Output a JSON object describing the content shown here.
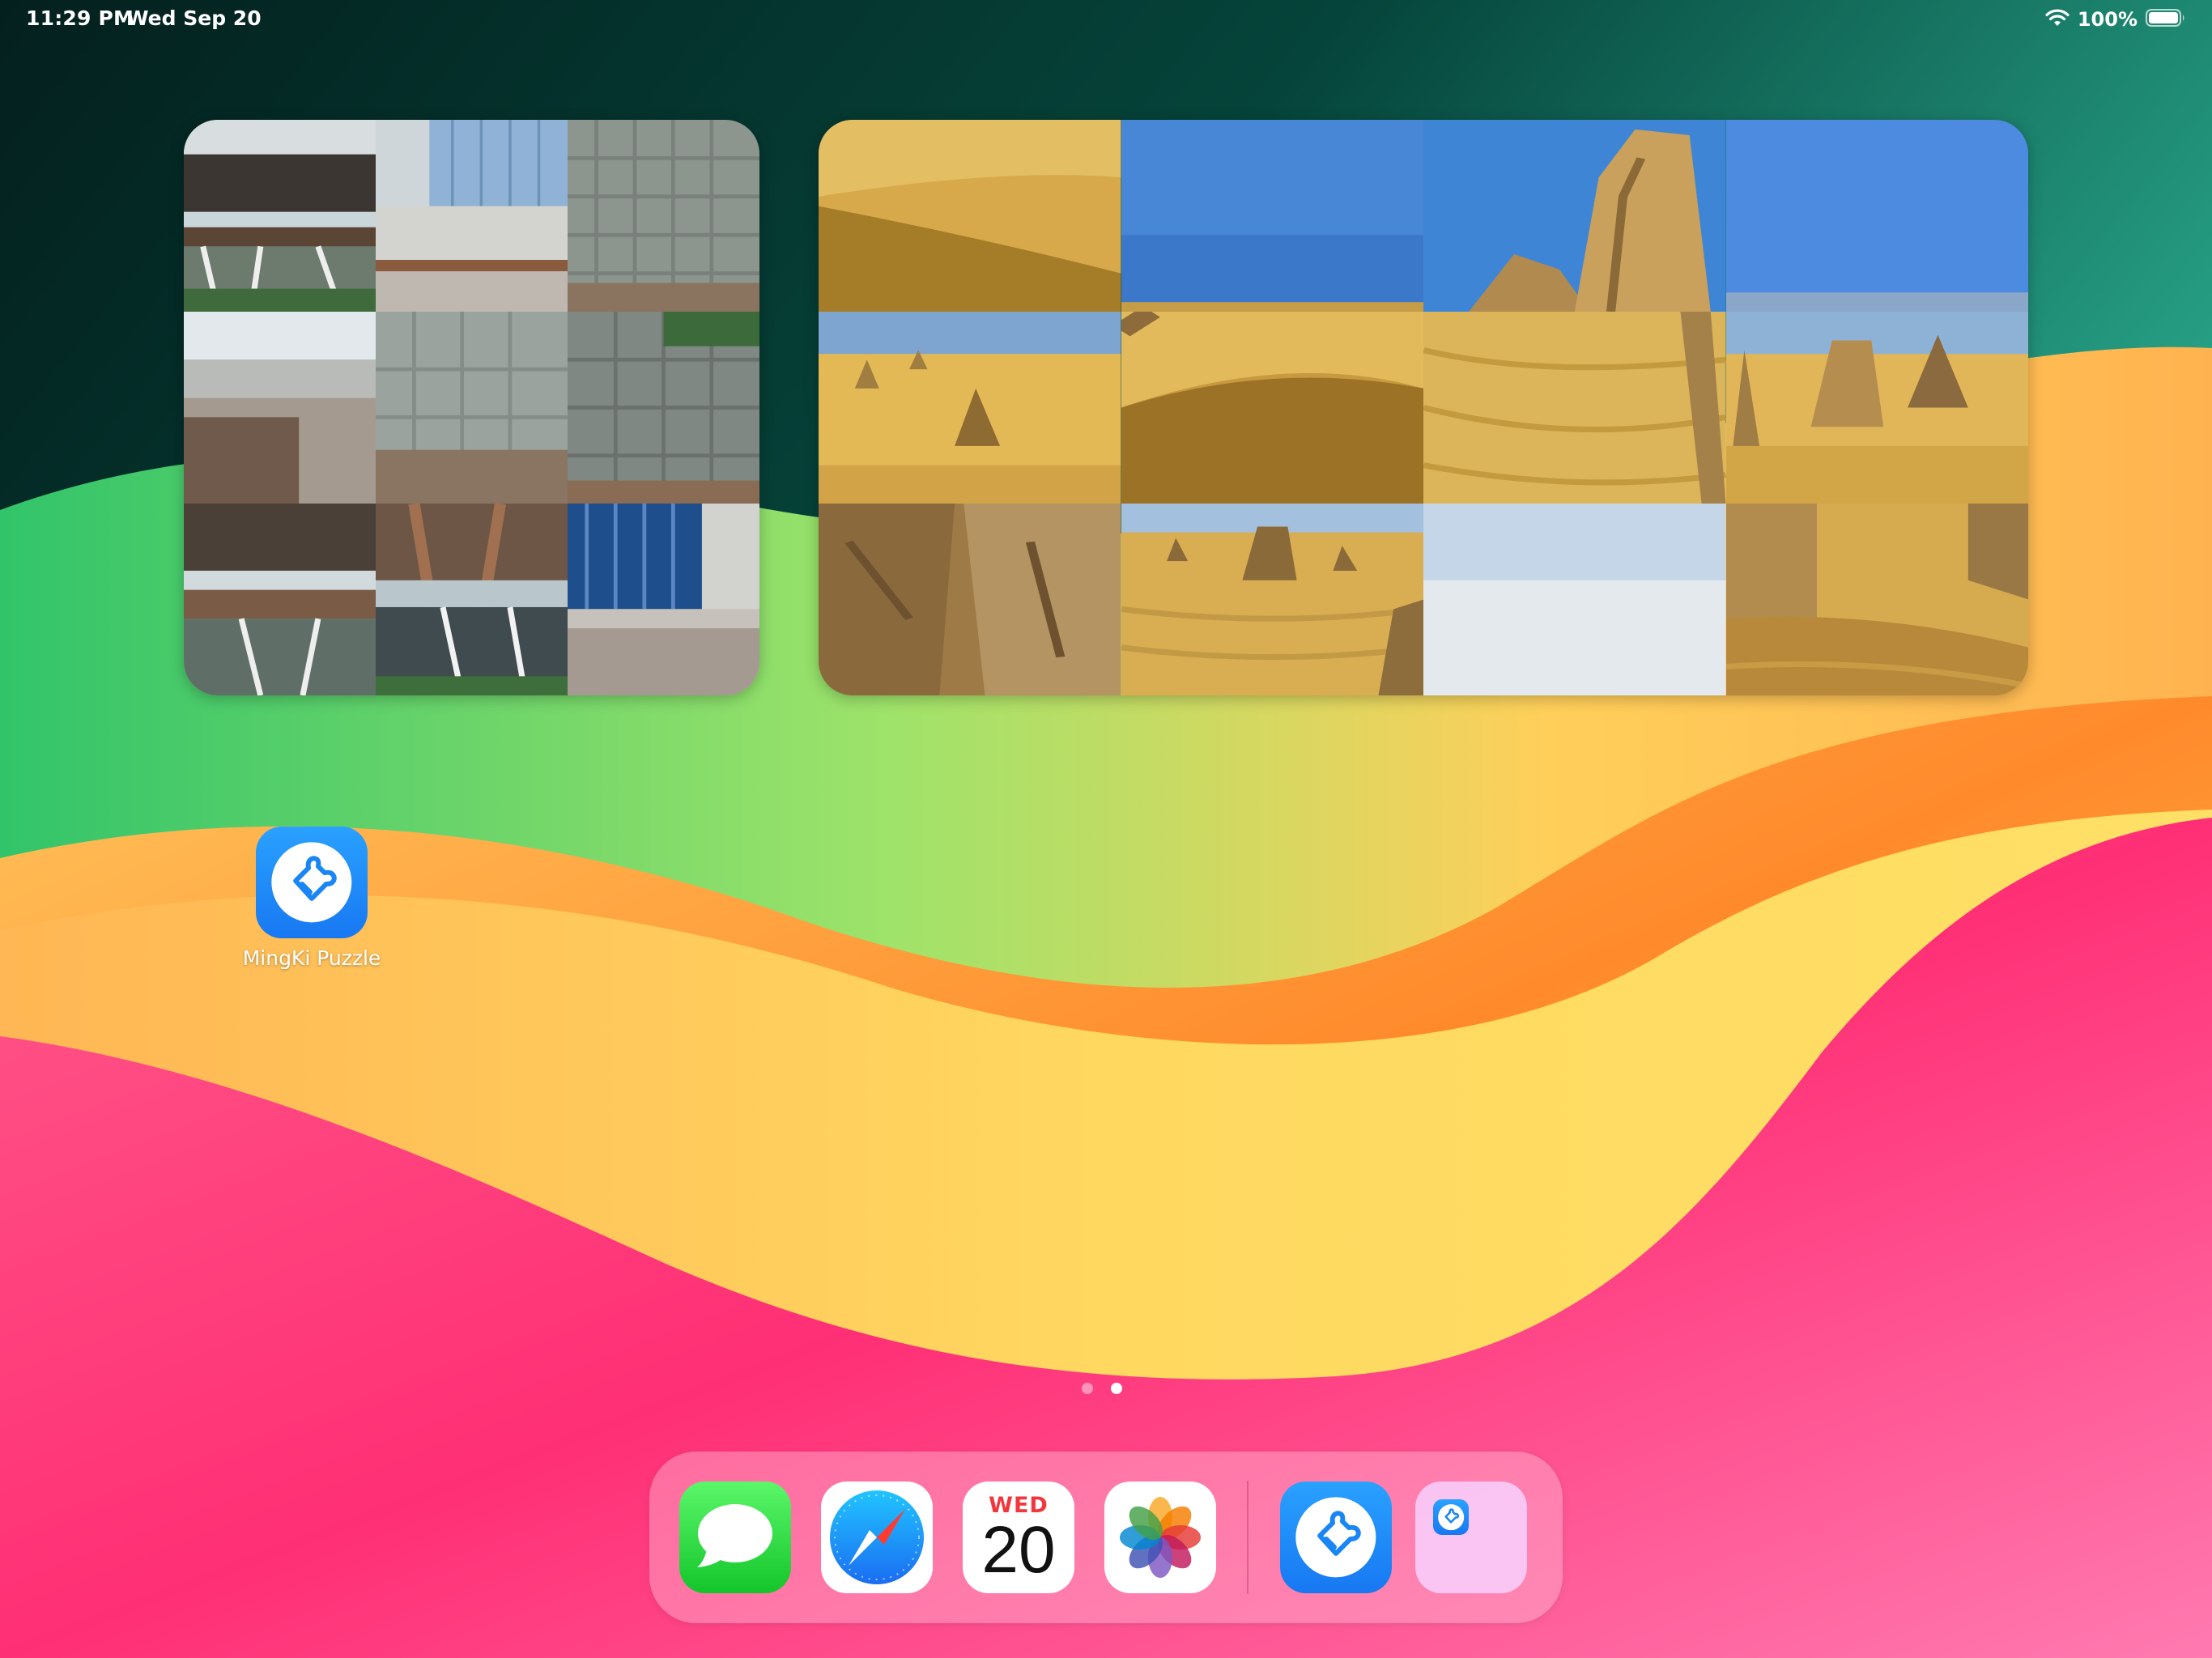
{
  "status_bar": {
    "time": "11:29 PM",
    "date": "Wed Sep 20",
    "battery_percent": "100%",
    "icons": [
      "wifi-icon",
      "battery-icon"
    ]
  },
  "widgets": [
    {
      "name": "photo-puzzle-city",
      "grid": [
        3,
        3
      ],
      "subject": "building exterior photo tiles"
    },
    {
      "name": "photo-puzzle-desert",
      "grid": [
        4,
        3
      ],
      "subject": "desert pinnacles photo tiles"
    }
  ],
  "home_apps": [
    {
      "label": "MingKi Puzzle",
      "icon": "puzzle-piece-icon",
      "color": "#1a86f5"
    }
  ],
  "page_indicator": {
    "count": 2,
    "active": 2
  },
  "dock": {
    "apps": [
      {
        "name": "Messages",
        "icon": "speech-bubble-icon",
        "color": "#2bd44a"
      },
      {
        "name": "Safari",
        "icon": "compass-icon",
        "color": "#1a8cff"
      },
      {
        "name": "Calendar",
        "icon": "calendar-icon",
        "day": "WED",
        "date": "20"
      },
      {
        "name": "Photos",
        "icon": "photos-flower-icon"
      }
    ],
    "recent": [
      {
        "name": "MingKi Puzzle",
        "icon": "puzzle-piece-icon",
        "color": "#1a86f5"
      },
      {
        "name": "App Library",
        "icon": "folder-icon",
        "color": "#f8c8f2"
      }
    ]
  },
  "colors": {
    "wallpaper_top": "#053a33",
    "wallpaper_teal": "#2ec6a0",
    "wallpaper_green": "#8ee05c",
    "wallpaper_orange": "#ff9a2e",
    "wallpaper_yellow": "#ffd45a",
    "wallpaper_pink": "#ff2f7a"
  }
}
